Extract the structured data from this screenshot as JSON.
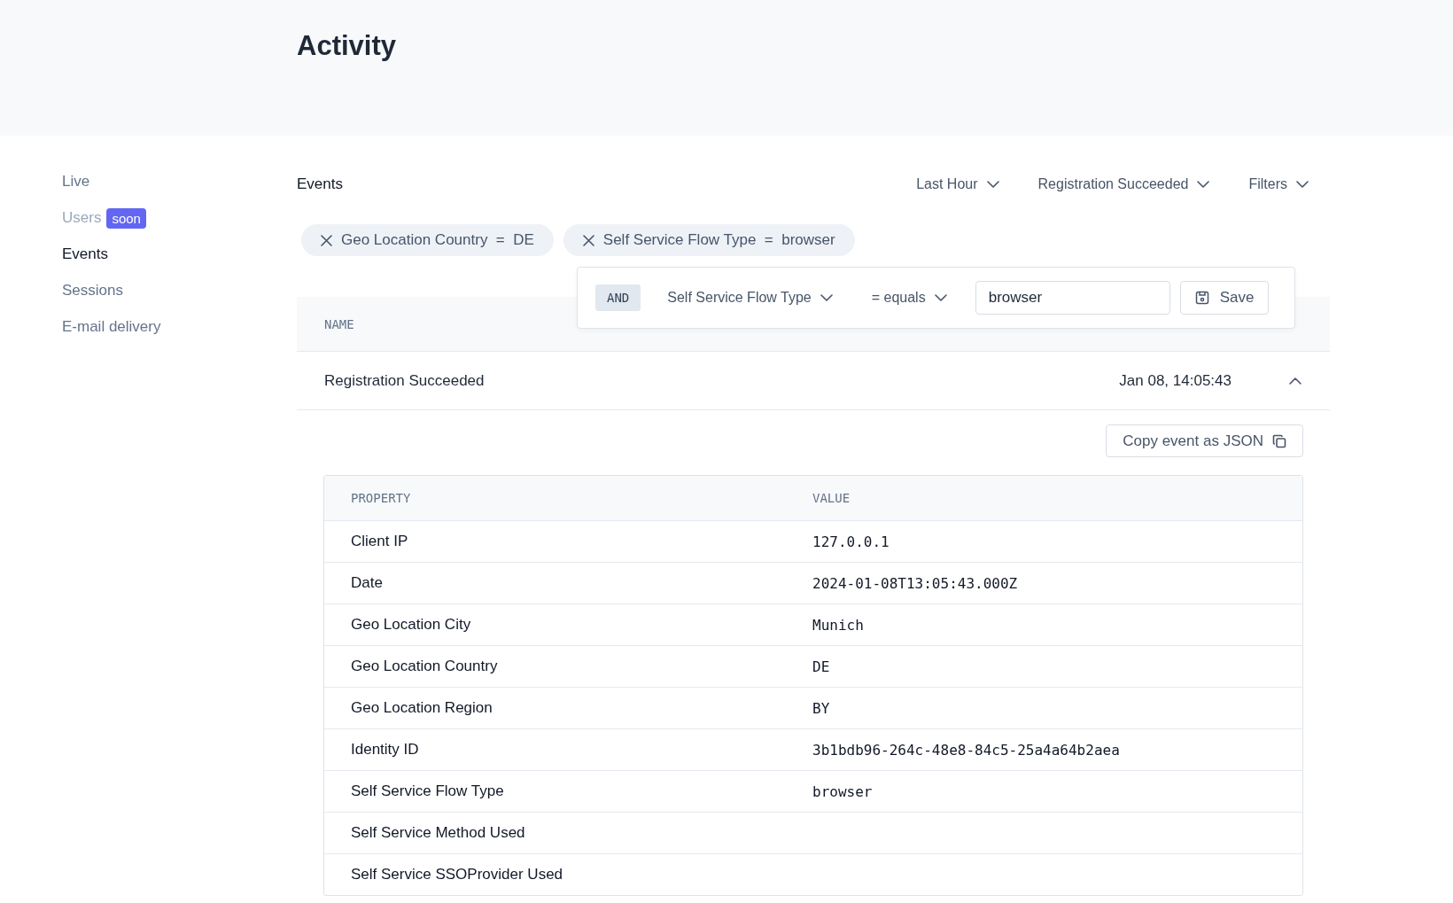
{
  "page": {
    "title": "Activity"
  },
  "sidebar": {
    "items": [
      {
        "label": "Live",
        "selected": false,
        "disabled": false
      },
      {
        "label": "Users",
        "selected": false,
        "disabled": true,
        "badge": "soon"
      },
      {
        "label": "Events",
        "selected": true,
        "disabled": false
      },
      {
        "label": "Sessions",
        "selected": false,
        "disabled": false
      },
      {
        "label": "E-mail delivery",
        "selected": false,
        "disabled": false
      }
    ]
  },
  "section_title": "Events",
  "dropdowns": [
    "Last Hour",
    "Registration Succeeded",
    "Filters"
  ],
  "filter_chips": [
    {
      "field": "Geo Location Country",
      "operator": "=",
      "value": "DE"
    },
    {
      "field": "Self Service Flow Type",
      "operator": "=",
      "value": "browser"
    }
  ],
  "filter_editor": {
    "connector": "AND",
    "field": "Self Service Flow Type",
    "operator": "= equals",
    "value": "browser",
    "save": "Save"
  },
  "table": {
    "columns": [
      "NAME"
    ],
    "rows": [
      {
        "name": "Registration Succeeded",
        "date": "Jan 08, 14:05:43",
        "expanded": true
      }
    ]
  },
  "details": {
    "copy_button": "Copy event as JSON",
    "columns": [
      "PROPERTY",
      "VALUE"
    ],
    "rows": [
      {
        "property": "Client IP",
        "value": "127.0.0.1"
      },
      {
        "property": "Date",
        "value": "2024-01-08T13:05:43.000Z"
      },
      {
        "property": "Geo Location City",
        "value": "Munich"
      },
      {
        "property": "Geo Location Country",
        "value": "DE"
      },
      {
        "property": "Geo Location Region",
        "value": "BY"
      },
      {
        "property": "Identity ID",
        "value": "3b1bdb96-264c-48e8-84c5-25a4a64b2aea"
      },
      {
        "property": "Self Service Flow Type",
        "value": "browser"
      },
      {
        "property": "Self Service Method Used"
      },
      {
        "property": "Self Service SSOProvider Used"
      }
    ]
  }
}
